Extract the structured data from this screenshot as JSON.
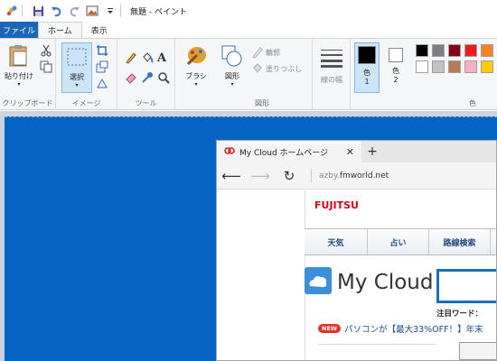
{
  "app": {
    "title": "無題 - ペイント"
  },
  "tabs": {
    "file": "ファイル",
    "home": "ホーム",
    "view": "表示"
  },
  "ribbon": {
    "clipboard": {
      "paste_label": "貼り付け",
      "group_label": "クリップボード"
    },
    "image": {
      "select_label": "選択",
      "group_label": "イメージ"
    },
    "tools": {
      "group_label": "ツール"
    },
    "shapes": {
      "brush_label": "ブラシ",
      "shapes_label": "図形",
      "outline_label": "輪郭",
      "fill_label": "塗りつぶし",
      "group_label": "図形"
    },
    "size": {
      "label": "線の幅"
    },
    "colors": {
      "color1_label": "色\n1",
      "color1_top": "色",
      "color1_num": "1",
      "color2_top": "色",
      "color2_num": "2",
      "color1_value": "#000000",
      "color2_value": "#ffffff",
      "group_label": "色",
      "palette": [
        "#000000",
        "#7f7f7f",
        "#880015",
        "#ed1c24",
        "#ff7f27",
        "#fff200",
        "#ffffff",
        "#c3c3c3",
        "#b97a57",
        "#ffaec9",
        "#ffc90e",
        "#efe4b0"
      ]
    }
  },
  "browser": {
    "tab_title": "My Cloud ホームページ",
    "address_host": "azby.",
    "address_domain": "fmworld.net",
    "page": {
      "logo": "FUJITSU",
      "nav": [
        "天気",
        "占い",
        "路線検索",
        ""
      ],
      "brand": "My Cloud",
      "trend_label": "注目ワード：",
      "new_badge": "NEW",
      "promo": "パソコンが【最大33%OFF！】年末"
    }
  }
}
